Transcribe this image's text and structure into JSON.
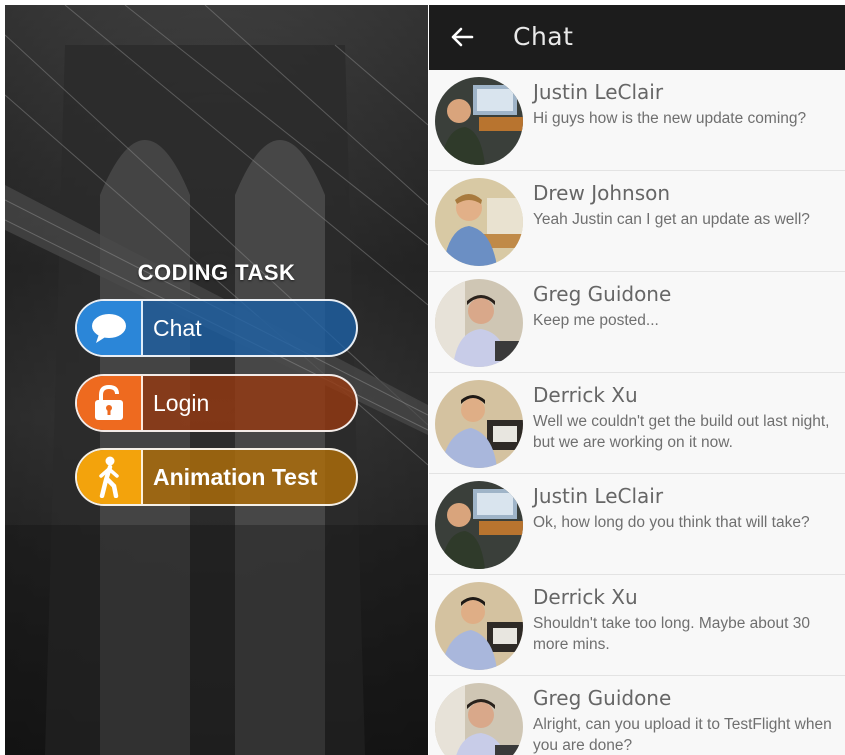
{
  "menu": {
    "title": "CODING TASK",
    "buttons": [
      {
        "label": "Chat",
        "icon": "chat-bubble-icon",
        "color": "#2b86d8"
      },
      {
        "label": "Login",
        "icon": "lock-icon",
        "color": "#ee6a1f"
      },
      {
        "label": "Animation Test",
        "icon": "walking-person-icon",
        "color": "#f3a30c"
      }
    ]
  },
  "chat": {
    "title": "Chat",
    "back_icon": "arrow-left-icon",
    "messages": [
      {
        "name": "Justin LeClair",
        "text": "Hi guys how is the new update coming?"
      },
      {
        "name": "Drew Johnson",
        "text": "Yeah Justin can I get an update as well?"
      },
      {
        "name": "Greg Guidone",
        "text": "Keep me posted..."
      },
      {
        "name": "Derrick Xu",
        "text": "Well we couldn't get the build out last night, but we are working on it now."
      },
      {
        "name": "Justin LeClair",
        "text": "Ok, how long do you think that will take?"
      },
      {
        "name": "Derrick Xu",
        "text": "Shouldn't take too long. Maybe about 30 more mins."
      },
      {
        "name": "Greg Guidone",
        "text": "Alright, can you upload it to TestFlight when you are done?"
      }
    ]
  }
}
